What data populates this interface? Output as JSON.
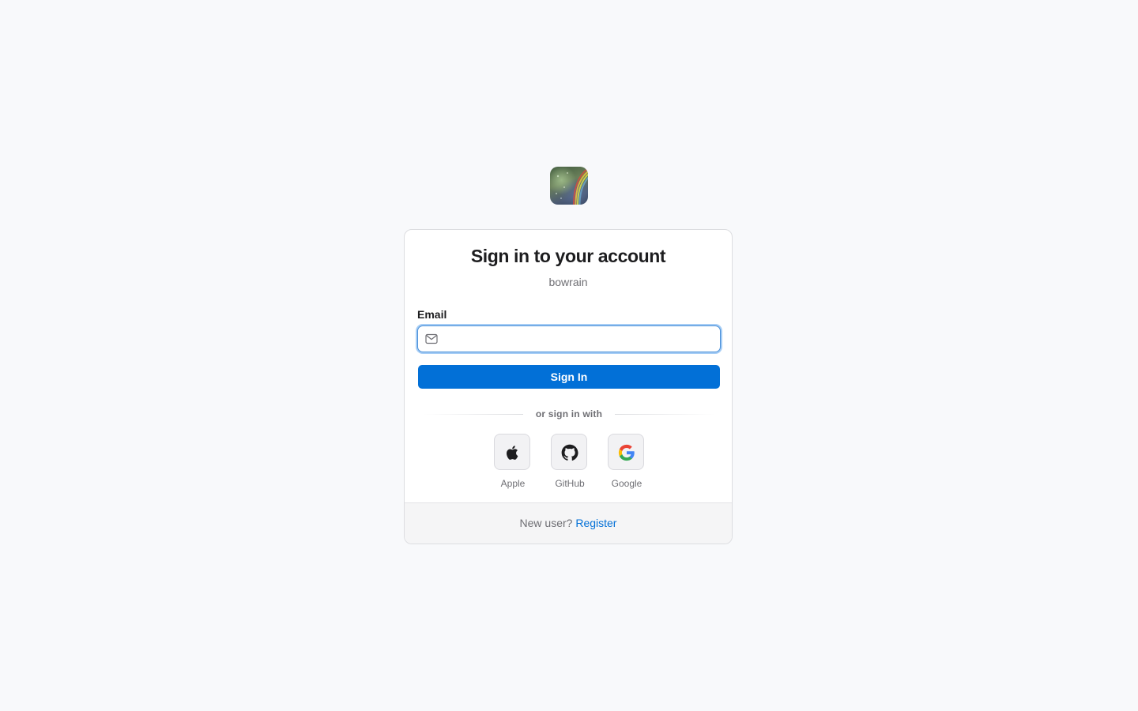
{
  "app": {
    "logo_icon": "app-logo-rainbow-photo",
    "title": "Sign in to your account",
    "subtitle": "bowrain"
  },
  "form": {
    "email_label": "Email",
    "email_value": "",
    "email_placeholder": "",
    "email_icon": "mail-icon",
    "submit_label": "Sign In"
  },
  "divider": {
    "text": "or sign in with"
  },
  "providers": [
    {
      "label": "Apple",
      "icon": "apple-icon"
    },
    {
      "label": "GitHub",
      "icon": "github-icon"
    },
    {
      "label": "Google",
      "icon": "google-icon"
    }
  ],
  "footer": {
    "prompt": "New user?",
    "link_label": "Register"
  },
  "colors": {
    "background": "#f8f9fb",
    "primary": "#0270d7",
    "focus_ring": "#4a90d9",
    "muted_text": "#6e6e73"
  }
}
